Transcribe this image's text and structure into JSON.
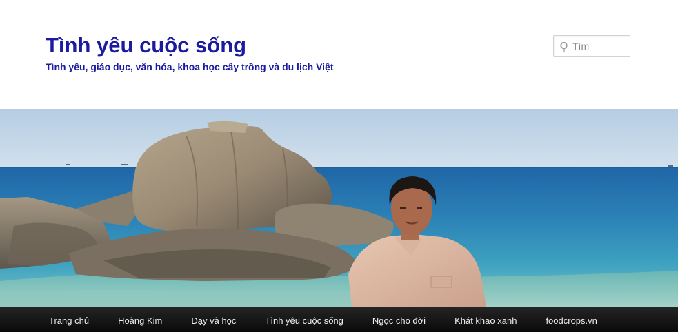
{
  "header": {
    "site_title": "Tình yêu cuộc sống",
    "site_description": "Tình yêu, giáo dục, văn hóa, khoa học cây trồng và du lịch Việt"
  },
  "search": {
    "placeholder": "Tìm",
    "value": ""
  },
  "banner": {
    "image": "header-photo",
    "content": "man-by-sea-rocks"
  },
  "nav": {
    "items": [
      {
        "label": "Trang chủ"
      },
      {
        "label": "Hoàng Kim"
      },
      {
        "label": "Dạy và học"
      },
      {
        "label": "Tình yêu cuộc sống"
      },
      {
        "label": "Ngọc cho đời"
      },
      {
        "label": "Khát khao xanh"
      },
      {
        "label": "foodcrops.vn"
      }
    ]
  },
  "colors": {
    "title": "#1b1ba0",
    "nav_bg": "#151515",
    "nav_text": "#eeeeee"
  }
}
